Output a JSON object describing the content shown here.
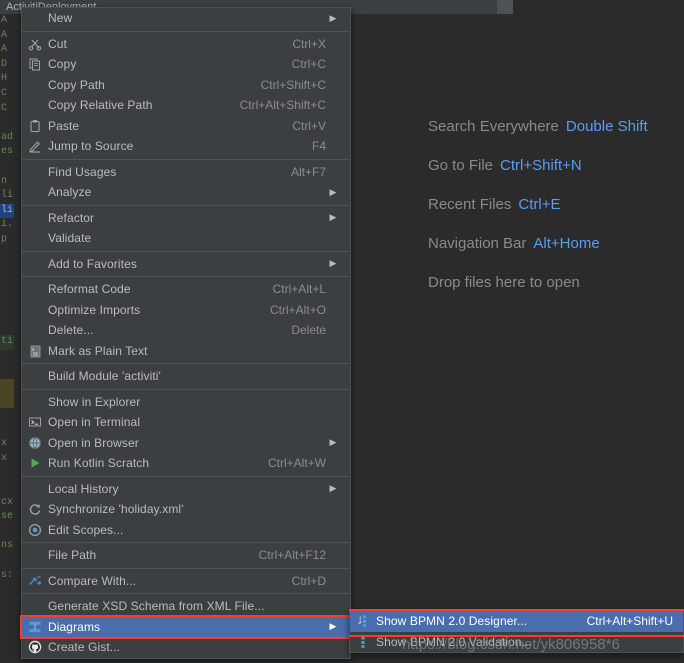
{
  "window": {
    "tab_title": "ActivitiDeployment"
  },
  "editor_sliver": [
    "A",
    "A",
    "A",
    "D",
    "H",
    "C",
    "C",
    "",
    "ad",
    "es",
    "",
    "n",
    "li",
    "li",
    "i.",
    "p",
    "",
    "",
    "",
    "",
    "",
    "",
    "tiv",
    "",
    "",
    "",
    "",
    "",
    "",
    "x",
    "x",
    "",
    "",
    "cx",
    "se",
    "",
    "ns",
    "",
    "s:"
  ],
  "hints": [
    {
      "label": "Search Everywhere",
      "shortcut": "Double Shift"
    },
    {
      "label": "Go to File",
      "shortcut": "Ctrl+Shift+N"
    },
    {
      "label": "Recent Files",
      "shortcut": "Ctrl+E"
    },
    {
      "label": "Navigation Bar",
      "shortcut": "Alt+Home"
    },
    {
      "label": "Drop files here to open",
      "shortcut": ""
    }
  ],
  "context_menu": {
    "items": [
      {
        "label": "New",
        "shortcut": "",
        "icon": "",
        "submenu": true,
        "separator_after": true
      },
      {
        "label": "Cut",
        "shortcut": "Ctrl+X",
        "icon": "scissors-icon",
        "submenu": false
      },
      {
        "label": "Copy",
        "shortcut": "Ctrl+C",
        "icon": "copy-icon",
        "submenu": false
      },
      {
        "label": "Copy Path",
        "shortcut": "Ctrl+Shift+C",
        "icon": "",
        "submenu": false
      },
      {
        "label": "Copy Relative Path",
        "shortcut": "Ctrl+Alt+Shift+C",
        "icon": "",
        "submenu": false
      },
      {
        "label": "Paste",
        "shortcut": "Ctrl+V",
        "icon": "clipboard-icon",
        "submenu": false
      },
      {
        "label": "Jump to Source",
        "shortcut": "F4",
        "icon": "pencil-icon",
        "submenu": false,
        "separator_after": true
      },
      {
        "label": "Find Usages",
        "shortcut": "Alt+F7",
        "icon": "",
        "submenu": false
      },
      {
        "label": "Analyze",
        "shortcut": "",
        "icon": "",
        "submenu": true,
        "separator_after": true
      },
      {
        "label": "Refactor",
        "shortcut": "",
        "icon": "",
        "submenu": true
      },
      {
        "label": "Validate",
        "shortcut": "",
        "icon": "",
        "submenu": false,
        "separator_after": true
      },
      {
        "label": "Add to Favorites",
        "shortcut": "",
        "icon": "",
        "submenu": true,
        "separator_after": true
      },
      {
        "label": "Reformat Code",
        "shortcut": "Ctrl+Alt+L",
        "icon": "",
        "submenu": false
      },
      {
        "label": "Optimize Imports",
        "shortcut": "Ctrl+Alt+O",
        "icon": "",
        "submenu": false
      },
      {
        "label": "Delete...",
        "shortcut": "Delete",
        "icon": "",
        "submenu": false
      },
      {
        "label": "Mark as Plain Text",
        "shortcut": "",
        "icon": "plain-text-icon",
        "submenu": false,
        "separator_after": true
      },
      {
        "label": "Build Module 'activiti'",
        "shortcut": "",
        "icon": "",
        "submenu": false,
        "separator_after": true
      },
      {
        "label": "Show in Explorer",
        "shortcut": "",
        "icon": "",
        "submenu": false
      },
      {
        "label": "Open in Terminal",
        "shortcut": "",
        "icon": "terminal-icon",
        "submenu": false
      },
      {
        "label": "Open in Browser",
        "shortcut": "",
        "icon": "globe-icon",
        "submenu": true
      },
      {
        "label": "Run Kotlin Scratch",
        "shortcut": "Ctrl+Alt+W",
        "icon": "run-icon",
        "submenu": false,
        "separator_after": true
      },
      {
        "label": "Local History",
        "shortcut": "",
        "icon": "",
        "submenu": true
      },
      {
        "label": "Synchronize 'holiday.xml'",
        "shortcut": "",
        "icon": "refresh-icon",
        "submenu": false
      },
      {
        "label": "Edit Scopes...",
        "shortcut": "",
        "icon": "scopes-icon",
        "submenu": false,
        "separator_after": true
      },
      {
        "label": "File Path",
        "shortcut": "Ctrl+Alt+F12",
        "icon": "",
        "submenu": false,
        "separator_after": true
      },
      {
        "label": "Compare With...",
        "shortcut": "Ctrl+D",
        "icon": "compare-icon",
        "submenu": false,
        "separator_after": true
      },
      {
        "label": "Generate XSD Schema from XML File...",
        "shortcut": "",
        "icon": "",
        "submenu": false
      },
      {
        "label": "Diagrams",
        "shortcut": "",
        "icon": "diagram-icon",
        "submenu": true,
        "selected": true,
        "highlighted": true
      },
      {
        "label": "Create Gist...",
        "shortcut": "",
        "icon": "github-icon",
        "submenu": false
      }
    ]
  },
  "submenu": {
    "items": [
      {
        "label": "Show BPMN 2.0 Designer...",
        "shortcut": "Ctrl+Alt+Shift+U",
        "icon": "bpmn-designer-icon",
        "selected": true
      },
      {
        "label": "Show BPMN 2.0 Validation...",
        "shortcut": "",
        "icon": "bpmn-validation-icon",
        "selected": false
      }
    ]
  },
  "watermark": {
    "text": "https://blog.csdn.net/yk806958*6"
  },
  "colors": {
    "menu_bg": "#3c3f41",
    "editor_bg": "#2b2b2b",
    "selection_blue": "#4a6dae",
    "annotation_red": "#ff3b30",
    "hint_key_blue": "#589df6",
    "text": "#bbbbbb"
  }
}
